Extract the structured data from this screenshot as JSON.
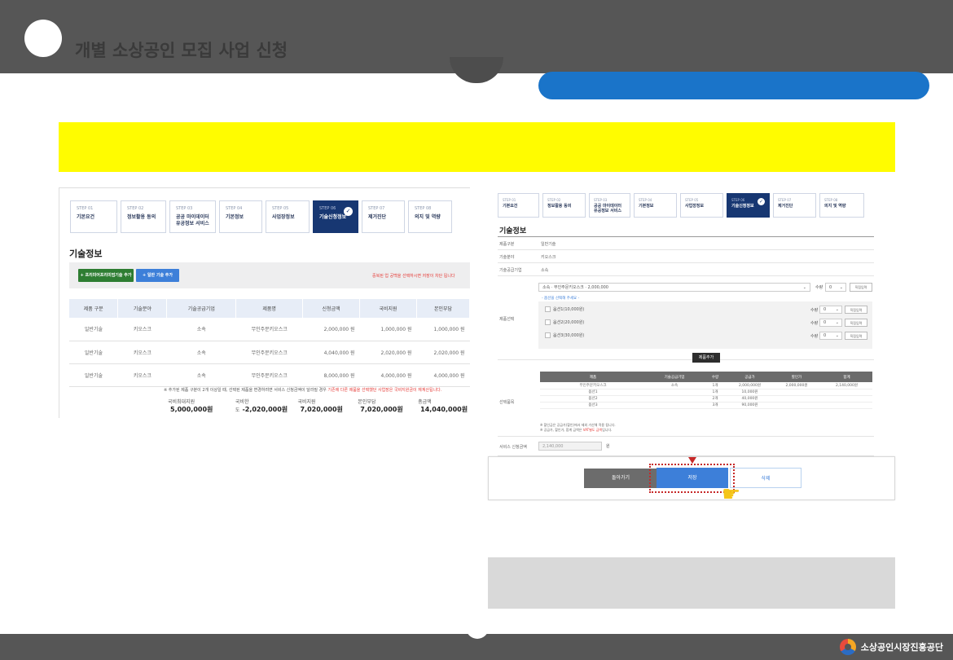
{
  "header": {
    "title": "개별 소상공인 모집 사업 신청"
  },
  "footer": {
    "org": "소상공인시장진흥공단"
  },
  "left": {
    "steps": [
      {
        "num": "STEP 01",
        "label": "기본요건"
      },
      {
        "num": "STEP 02",
        "label": "정보활용 동의"
      },
      {
        "num": "STEP 03",
        "label": "공공 마이데이터 유공정보 서비스"
      },
      {
        "num": "STEP 04",
        "label": "기본정보"
      },
      {
        "num": "STEP 05",
        "label": "사업장정보"
      },
      {
        "num": "STEP 06",
        "label": "기술신청정보"
      },
      {
        "num": "STEP 07",
        "label": "제거진단"
      },
      {
        "num": "STEP 08",
        "label": "의지 및 역량"
      }
    ],
    "section_title": "기술정보",
    "add_premium_label": "+ 프리미어프리미엄기술 추가",
    "add_general_label": "+ 일반 기술 추가",
    "red_hint": "중복된 업 공백을 선택하시면 저장이 차단 됩니다",
    "table": {
      "headers": [
        "제품 구분",
        "기술분야",
        "기술공급기업",
        "제품명",
        "신청금액",
        "국비지원",
        "본인부담"
      ],
      "rows": [
        [
          "일반기술",
          "키오스크",
          "소속",
          "무인주문키오스크",
          "2,000,000 원",
          "1,000,000 원",
          "1,000,000 원"
        ],
        [
          "일반기술",
          "키오스크",
          "소속",
          "무인주문키오스크",
          "4,040,000 원",
          "2,020,000 원",
          "2,020,000 원"
        ],
        [
          "일반기술",
          "키오스크",
          "소속",
          "무인주문키오스크",
          "8,000,000 원",
          "4,000,000 원",
          "4,000,000 원"
        ]
      ]
    },
    "note_text": "※ 추가된 제품 구분이 2개 이상일 때, 선택된 제품을 변경하려면 서비스 신청금액이 달라질 경우 ",
    "note_red": "기존에 다른 제품을 선택했던 사업장은 국비지원금이 재계산됩니다.",
    "totals": [
      {
        "label": "국비최대지원",
        "value": "5,000,000원"
      },
      {
        "label": "국비한도",
        "value": "-2,020,000원"
      },
      {
        "label": "국비지원",
        "value": "7,020,000원"
      },
      {
        "label": "본인부담",
        "value": "7,020,000원"
      },
      {
        "label": "총금액",
        "value": "14,040,000원"
      }
    ]
  },
  "right": {
    "steps": [
      {
        "num": "STEP 01",
        "label": "기본요건"
      },
      {
        "num": "STEP 02",
        "label": "정보활용 동의"
      },
      {
        "num": "STEP 03",
        "label": "공공 마이데이터 유공정보 서비스"
      },
      {
        "num": "STEP 04",
        "label": "기본정보"
      },
      {
        "num": "STEP 05",
        "label": "사업장정보"
      },
      {
        "num": "STEP 06",
        "label": "기술신청정보"
      },
      {
        "num": "STEP 07",
        "label": "제거진단"
      },
      {
        "num": "STEP 08",
        "label": "의지 및 역량"
      }
    ],
    "section_title": "기술정보",
    "fields": [
      {
        "label": "제품구분",
        "value": "일반기술"
      },
      {
        "label": "기술분야",
        "value": "키오스크"
      },
      {
        "label": "기술공급기업",
        "value": "소속"
      }
    ],
    "product_select_label": "제품선택",
    "product_select": "소속 · 무인주문키오스크 · 2,000,000",
    "qty_label": "수량",
    "qty_value": "0",
    "direct_input": "직접입력",
    "option_hint": "- 옵션을 선택해 주세요 -",
    "options": [
      {
        "label": "옵션1(10,000원)",
        "qty": "0"
      },
      {
        "label": "옵션2(20,000원)",
        "qty": "0"
      },
      {
        "label": "옵션3(30,000원)",
        "qty": "0"
      }
    ],
    "add_product_label": "제품추가",
    "selected_label": "선택품목",
    "selected_table": {
      "headers": [
        "제품",
        "기술공급기업",
        "수량",
        "공급가",
        "할인가",
        "합계"
      ],
      "rows": [
        [
          "무인주문키오스크",
          "소속",
          "1개",
          "2,000,000원",
          "2,000,000원",
          "2,140,000원"
        ],
        [
          "옵션1",
          "",
          "1개",
          "10,000원",
          "",
          ""
        ],
        [
          "옵션2",
          "",
          "2개",
          "40,000원",
          "",
          ""
        ],
        [
          "옵션3",
          "",
          "3개",
          "90,000원",
          "",
          ""
        ]
      ]
    },
    "footnote1": "※ 할인금은 공급가(할인)에서 제외 가산해 적용 됩니다.",
    "footnote2_prefix": "※ 공급가, 할인가, 합계 금액은 ",
    "footnote2_red": "VAT별도 금액",
    "footnote2_suffix": "입니다.",
    "service_total_label": "서비스 신청금액",
    "service_total_value": "2,140,000",
    "service_total_unit": "원",
    "back_label": "돌아가기",
    "save_label": "저장",
    "delete_label": "삭제"
  }
}
